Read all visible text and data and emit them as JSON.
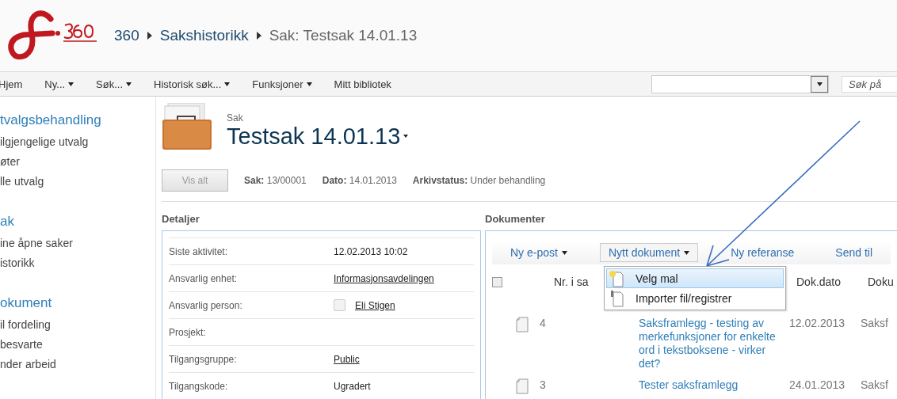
{
  "header": {
    "breadcrumb": [
      {
        "label": "360",
        "current": false
      },
      {
        "label": "Sakshistorikk",
        "current": false
      },
      {
        "label": "Sak: Testsak 14.01.13",
        "current": true
      }
    ]
  },
  "nav": {
    "items": [
      {
        "label": "Hjem",
        "dropdown": false
      },
      {
        "label": "Ny...",
        "dropdown": true
      },
      {
        "label": "Søk...",
        "dropdown": true
      },
      {
        "label": "Historisk søk...",
        "dropdown": true
      },
      {
        "label": "Funksjoner",
        "dropdown": true
      },
      {
        "label": "Mitt bibliotek",
        "dropdown": false
      }
    ],
    "search": {
      "placeholder": "Søk på"
    }
  },
  "sidebar": {
    "sections": [
      {
        "title": "tvalgsbehandling",
        "items": [
          "ilgjengelige utvalg",
          "øter",
          "lle utvalg"
        ]
      },
      {
        "title": "ak",
        "items": [
          "ine åpne saker",
          "istorikk"
        ]
      },
      {
        "title": "okument",
        "items": [
          "il fordeling",
          "besvarte",
          "nder arbeid"
        ]
      }
    ]
  },
  "case": {
    "type_label": "Sak",
    "title": "Testsak 14.01.13",
    "show_all_button": "Vis alt",
    "meta": [
      {
        "label": "Sak:",
        "value": "13/00001"
      },
      {
        "label": "Dato:",
        "value": "14.01.2013"
      },
      {
        "label": "Arkivstatus:",
        "value": "Under behandling"
      }
    ]
  },
  "details": {
    "title": "Detaljer",
    "rows": [
      {
        "label": "Siste aktivitet:",
        "value": "12.02.2013 10:02",
        "kind": "text"
      },
      {
        "label": "Ansvarlig enhet:",
        "value": "Informasjonsavdelingen",
        "kind": "link"
      },
      {
        "label": "Ansvarlig person:",
        "value": "Eli Stigen",
        "kind": "person",
        "checked": false
      },
      {
        "label": "Prosjekt:",
        "kind": "empty"
      },
      {
        "label": "Tilgangsgruppe:",
        "value": "Public",
        "kind": "link"
      },
      {
        "label": "Tilgangskode:",
        "value": "Ugradert",
        "kind": "text"
      }
    ]
  },
  "documents": {
    "title": "Dokumenter",
    "toolbar": [
      {
        "label": "Ny e-post",
        "dropdown": true,
        "open": false
      },
      {
        "label": "Nytt dokument",
        "dropdown": true,
        "open": true
      },
      {
        "label": "Ny referanse",
        "dropdown": false,
        "open": false
      },
      {
        "label": "Send til",
        "dropdown": false,
        "open": false
      }
    ],
    "menu": [
      {
        "label": "Velg mal",
        "selected": true,
        "kind": "new"
      },
      {
        "label": "Importer fil/registrer",
        "selected": false,
        "kind": "import"
      }
    ],
    "select_all_checked": false,
    "columns": [
      "Nr. i sa",
      "Dok.dato",
      "Doku"
    ],
    "rows": [
      {
        "number": "4",
        "title": "Saksframlegg - testing av merkefunksjoner for enkelte ord i tekstboksene - virker det?",
        "date": "12.02.2013",
        "column_4": "Saksf"
      },
      {
        "number": "3",
        "title": "Tester saksframlegg",
        "date": "24.01.2013",
        "column_4": "Saksf"
      }
    ]
  }
}
